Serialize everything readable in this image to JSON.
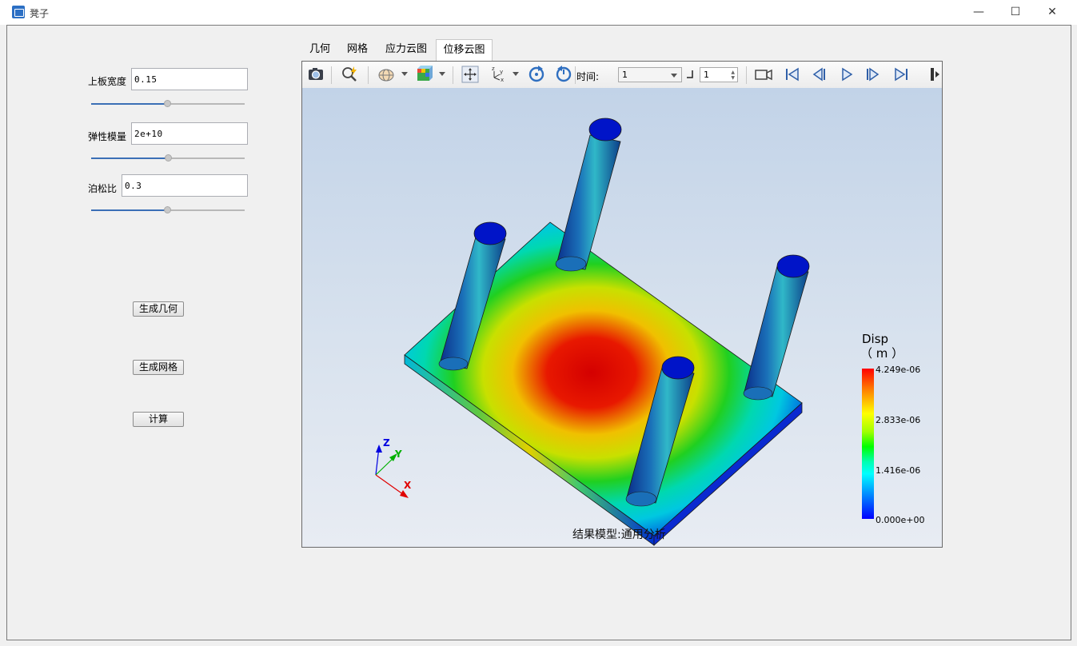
{
  "window": {
    "title": "凳子",
    "minimize": "—",
    "maximize": "☐",
    "close": "✕"
  },
  "params": {
    "width": {
      "label": "上板宽度",
      "value": "0.15",
      "slider_position": 0.5
    },
    "modulus": {
      "label": "弹性模量",
      "value": "2e+10",
      "slider_position": 0.5
    },
    "poisson": {
      "label": "泊松比",
      "value": "0.3",
      "slider_position": 0.5
    }
  },
  "buttons": {
    "gen_geometry": "生成几何",
    "gen_mesh": "生成网格",
    "compute": "计算"
  },
  "tabs": [
    {
      "label": "几何",
      "active": false
    },
    {
      "label": "网格",
      "active": false
    },
    {
      "label": "应力云图",
      "active": false
    },
    {
      "label": "位移云图",
      "active": true
    }
  ],
  "toolbar": {
    "time_label": "时间:",
    "time_value": "1",
    "frame_value": "1",
    "icons": [
      "camera-icon",
      "zoom-fit-icon",
      "display-mode-icon",
      "contour-style-icon",
      "pan-icon",
      "axes-icon",
      "rotate-cw-icon",
      "rotate-ccw-icon",
      "video-record-icon",
      "first-frame-icon",
      "prev-frame-icon",
      "play-icon",
      "next-frame-icon",
      "last-frame-icon",
      "toolbar-overflow-icon"
    ]
  },
  "legend": {
    "title": "Disp",
    "unit": "（ m ）",
    "values": [
      "4.249e-06",
      "2.833e-06",
      "1.416e-06",
      "0.000e+00"
    ]
  },
  "axes": {
    "z": "Z",
    "y": "Y",
    "x": "X"
  },
  "result_model_label": "结果模型:通用分析"
}
